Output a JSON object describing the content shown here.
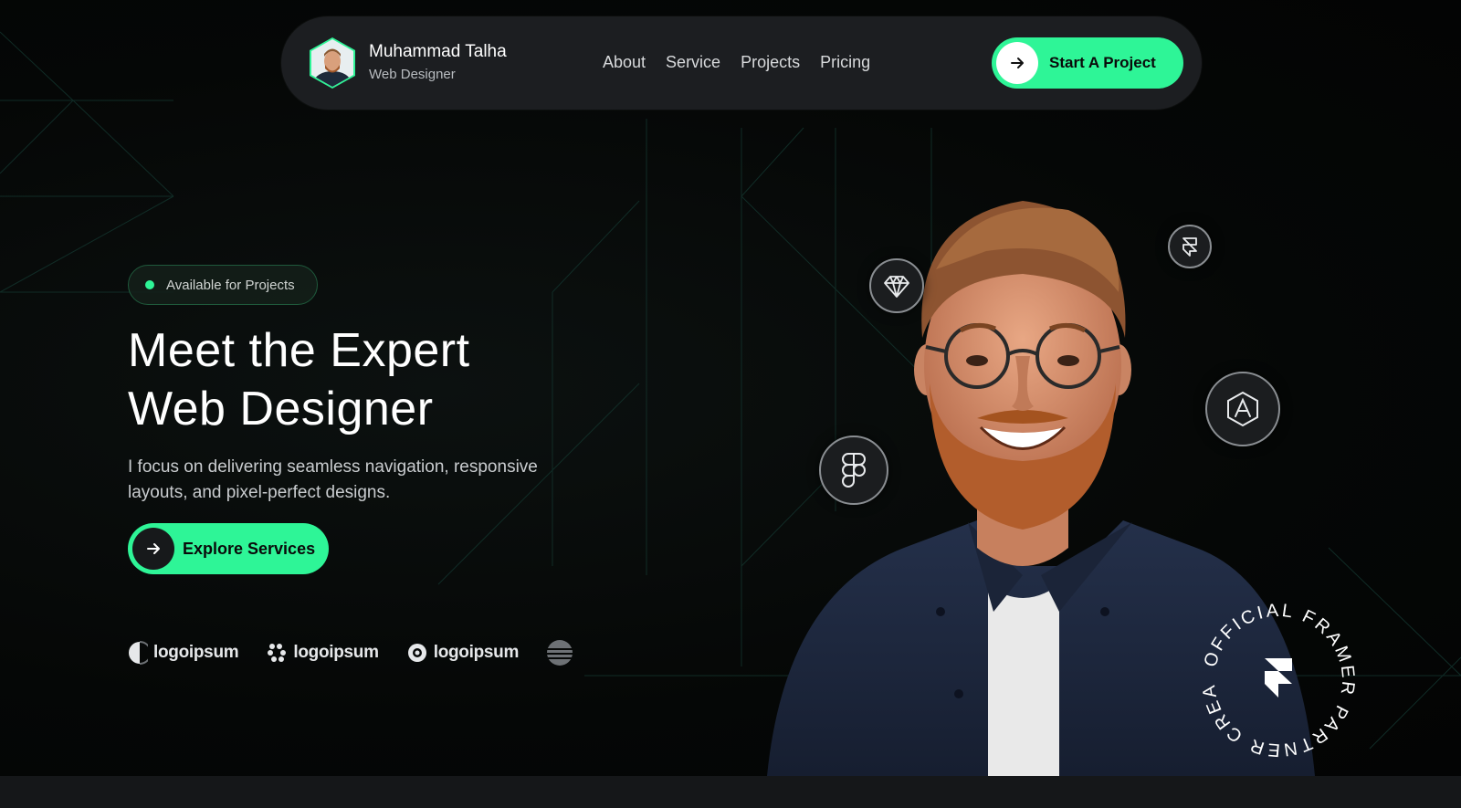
{
  "navbar": {
    "name": "Muhammad Talha",
    "role": "Web Designer",
    "links": [
      "About",
      "Service",
      "Projects",
      "Pricing"
    ],
    "cta_label": "Start A Project"
  },
  "hero": {
    "badge_text": "Available for Projects",
    "headline_line1": "Meet the Expert",
    "headline_line2": "Web Designer",
    "sub_line1": "I focus on delivering seamless navigation, responsive",
    "sub_line2": "layouts, and pixel-perfect designs.",
    "cta_label": "Explore Services"
  },
  "logos": [
    "logoipsum",
    "logoipsum",
    "logoipsum"
  ],
  "tool_icons": [
    "sketch-icon",
    "framer-icon",
    "figma-icon",
    "affinity-icon"
  ],
  "partner_badge": {
    "text": "OFFICIAL FRAMER PARTNER CREATOR"
  },
  "colors": {
    "accent": "#2ef597",
    "background": "#050706",
    "navbar": "#1c1e21"
  }
}
